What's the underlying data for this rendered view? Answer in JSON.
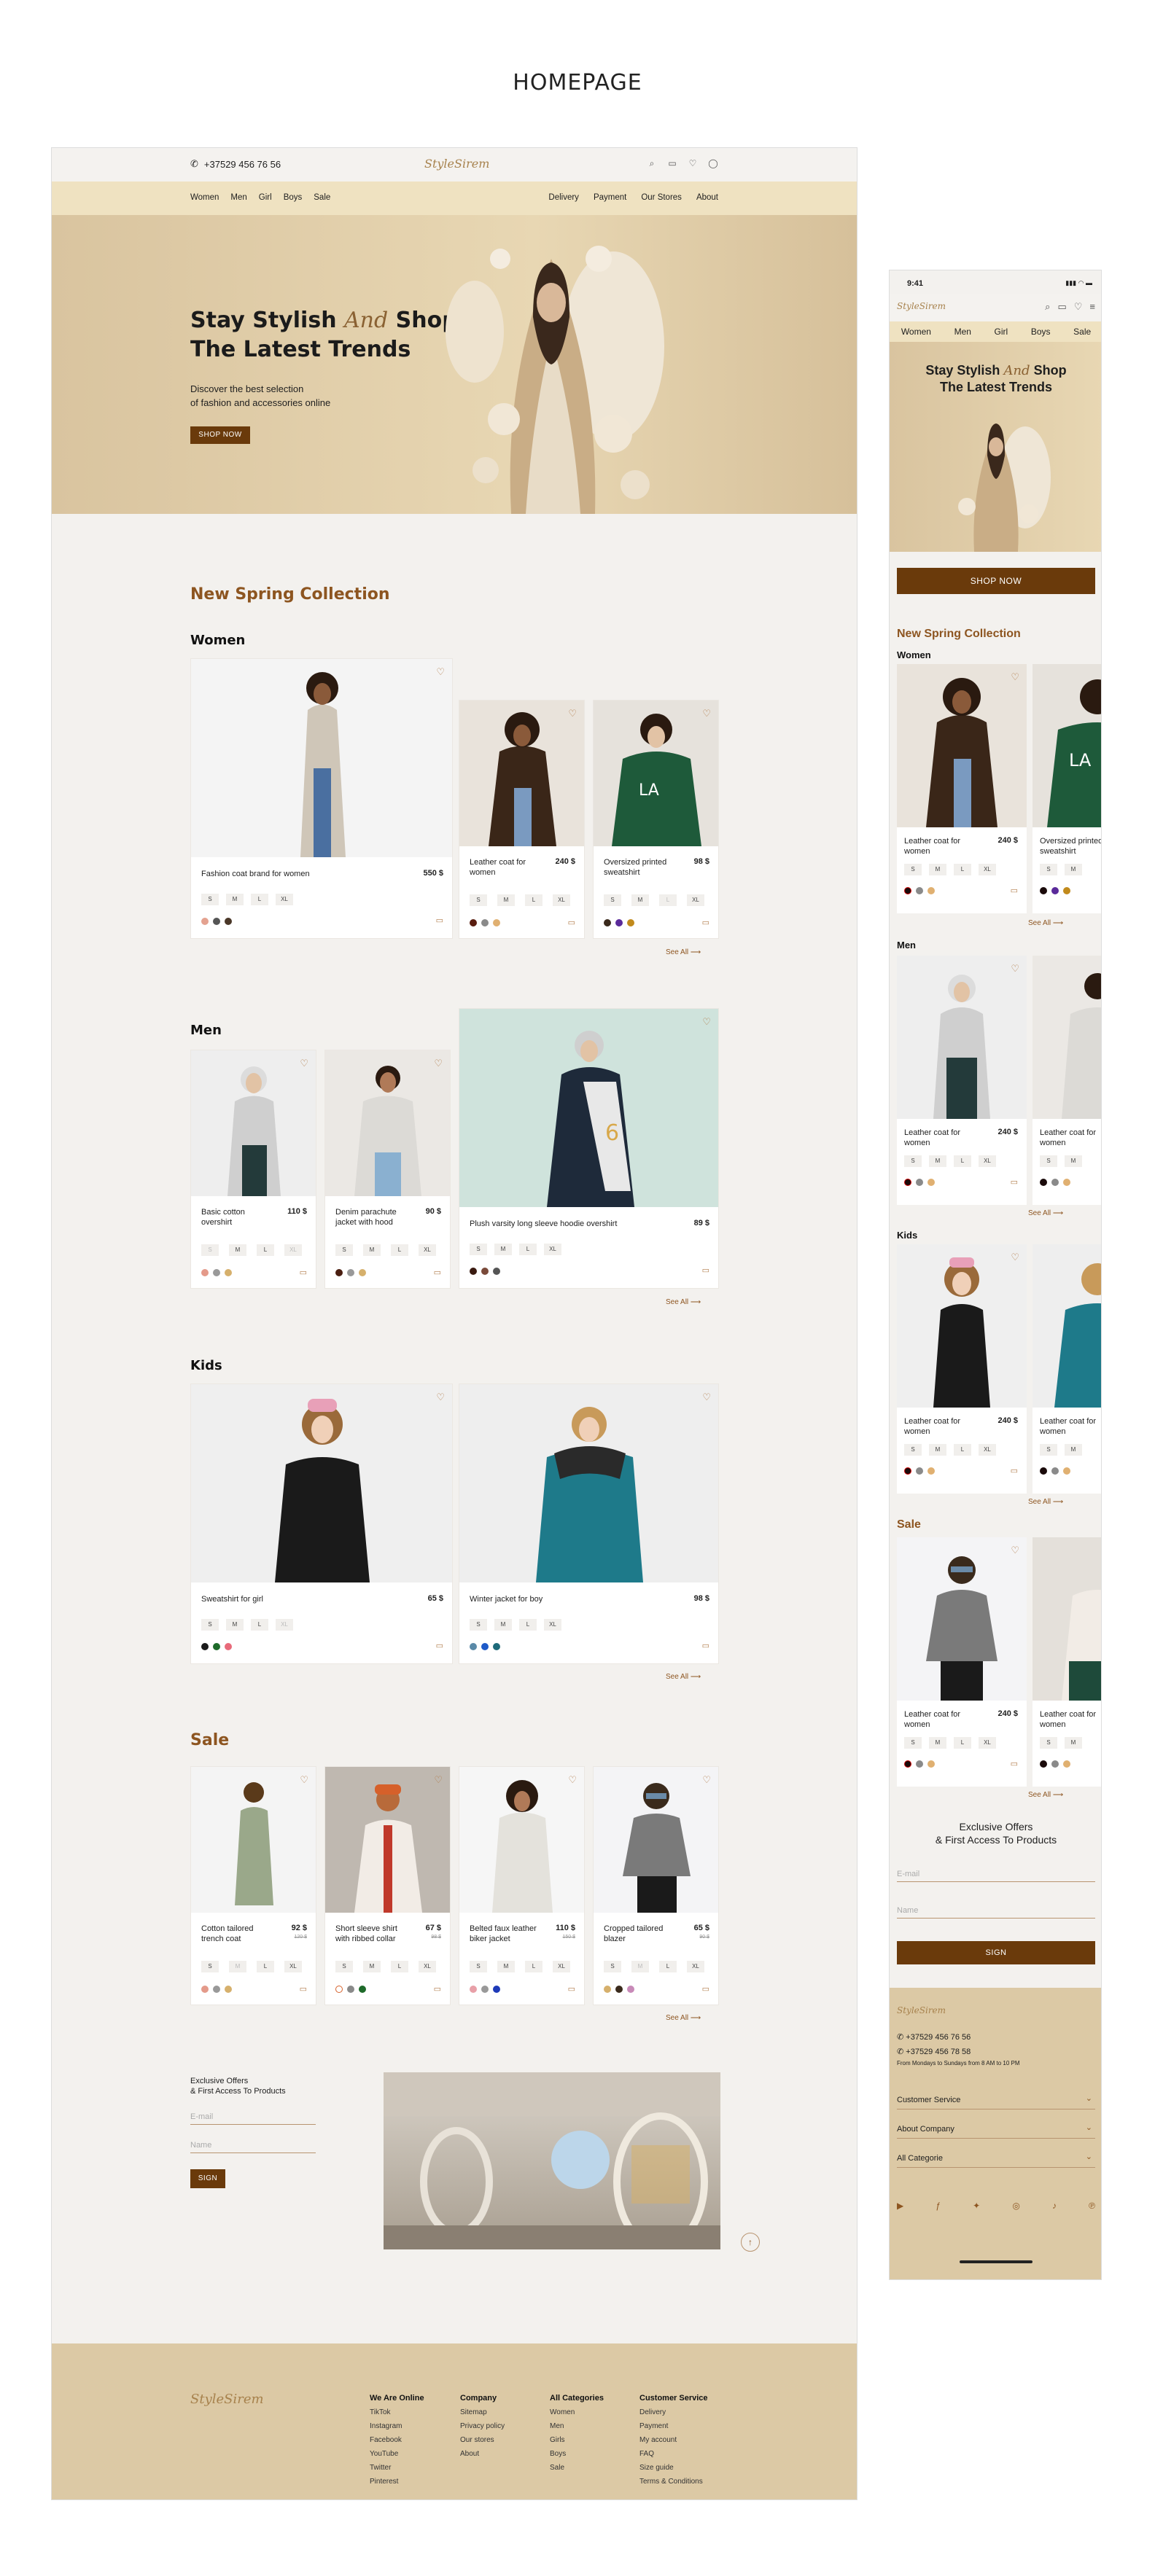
{
  "page_title": "HOMEPAGE",
  "brand": "StyleSirem",
  "topbar": {
    "phone": "+37529 456 76 56"
  },
  "nav_left": [
    "Women",
    "Men",
    "Girl",
    "Boys",
    "Sale"
  ],
  "nav_right": [
    "Delivery",
    "Payment",
    "Our Stores",
    "About"
  ],
  "hero": {
    "line1a": "Stay Stylish",
    "and": "And",
    "line1b": "Shop",
    "line2": "The Latest Trends",
    "sub1": "Discover the best selection",
    "sub2": "of fashion and accessories online",
    "button": "SHOP NOW"
  },
  "collection_title": "New Spring Collection",
  "categories": {
    "women": "Women",
    "men": "Men",
    "kids": "Kids",
    "sale": "Sale"
  },
  "see_all": "See All",
  "women": [
    {
      "name": "Fashion coat brand for women",
      "price": "550 $",
      "sizes": [
        "S",
        "M",
        "L",
        "XL"
      ],
      "colors": [
        "#e4a290",
        "#555555",
        "#4a3728"
      ]
    },
    {
      "name": "Leather coat for women",
      "price": "240 $",
      "sizes": [
        "S",
        "M",
        "L",
        "XL"
      ],
      "colors": [
        "#5a1e10",
        "#8a8a8a",
        "#e0b071"
      ]
    },
    {
      "name": "Oversized printed sweatshirt",
      "price": "98 $",
      "sizes": [
        "S",
        "M",
        "L",
        "XL"
      ],
      "colors": [
        "#3a2a1c",
        "#5a2a9a",
        "#c18a1c"
      ]
    }
  ],
  "men": [
    {
      "name": "Basic cotton overshirt",
      "price": "110 $",
      "sizes": [
        "S",
        "M",
        "L",
        "XL"
      ],
      "colors": [
        "#e49a8a",
        "#999999",
        "#d6b06c"
      ]
    },
    {
      "name": "Denim parachute jacket with hood",
      "price": "90 $",
      "sizes": [
        "S",
        "M",
        "L",
        "XL"
      ],
      "colors": [
        "#4a1e10",
        "#999999",
        "#d6b06c"
      ]
    },
    {
      "name": "Plush varsity long sleeve hoodie overshirt",
      "price": "89 $",
      "sizes": [
        "S",
        "M",
        "L",
        "XL"
      ],
      "colors": [
        "#3a1a10",
        "#7a4a3a",
        "#555555"
      ]
    }
  ],
  "kids": [
    {
      "name": "Sweatshirt for girl",
      "price": "65 $",
      "sizes": [
        "S",
        "M",
        "L",
        "XL"
      ],
      "colors": [
        "#1a1a1a",
        "#1e6a2a",
        "#e86a7a"
      ]
    },
    {
      "name": "Winter jacket for boy",
      "price": "98 $",
      "sizes": [
        "S",
        "M",
        "L",
        "XL"
      ],
      "colors": [
        "#5a8aa8",
        "#1e5ac8",
        "#1e6a7a"
      ]
    }
  ],
  "sale": [
    {
      "name": "Cotton tailored trench coat",
      "price": "92 $",
      "old": "120 $",
      "sizes": [
        "S",
        "M",
        "L",
        "XL"
      ],
      "colors": [
        "#e49a8a",
        "#999999",
        "#d6b06c"
      ]
    },
    {
      "name": "Short sleeve shirt with ribbed collar",
      "price": "67 $",
      "old": "98 $",
      "sizes": [
        "S",
        "M",
        "L",
        "XL"
      ],
      "colors": [
        "#ffffff",
        "#8a8a8a",
        "#1e6a2a"
      ]
    },
    {
      "name": "Belted faux leather biker jacket",
      "price": "110 $",
      "old": "150 $",
      "sizes": [
        "S",
        "M",
        "L",
        "XL"
      ],
      "colors": [
        "#e8a0a8",
        "#999999",
        "#1e3ab8"
      ]
    },
    {
      "name": "Cropped tailored blazer",
      "price": "65 $",
      "old": "90 $",
      "sizes": [
        "S",
        "M",
        "L",
        "XL"
      ],
      "colors": [
        "#d6b06c",
        "#3a2a1c",
        "#c88ab8"
      ]
    }
  ],
  "subscribe": {
    "line1": "Exclusive Offers",
    "line2": "& First Access To Products",
    "email": "E-mail",
    "name": "Name",
    "button": "SIGN"
  },
  "footer": {
    "we_online": {
      "title": "We Are Online",
      "items": [
        "TikTok",
        "Instagram",
        "Facebook",
        "YouTube",
        "Twitter",
        "Pinterest"
      ]
    },
    "company": {
      "title": "Company",
      "items": [
        "Sitemap",
        "Privacy policy",
        "Our stores",
        "About"
      ]
    },
    "all_categories": {
      "title": "All Categories",
      "items": [
        "Women",
        "Men",
        "Girls",
        "Boys",
        "Sale"
      ]
    },
    "customer_service": {
      "title": "Customer Service",
      "items": [
        "Delivery",
        "Payment",
        "My account",
        "FAQ",
        "Size guide",
        "Terms & Conditions"
      ]
    }
  },
  "mobile": {
    "time": "9:41",
    "nav": [
      "Women",
      "Men",
      "Girl",
      "Boys",
      "Sale"
    ],
    "shop_now": "SHOP NOW",
    "card_name": "Leather coat for women",
    "card_price": "240 $",
    "card_name_b": "Oversized printed sweatshirt",
    "phones": [
      "+37529 456 76 56",
      "+37529 456 78 58"
    ],
    "hours": "From Mondays to Sundays from 8 AM to 10 PM",
    "accordion": [
      "Customer Service",
      "About Company",
      "All Categorie"
    ]
  }
}
